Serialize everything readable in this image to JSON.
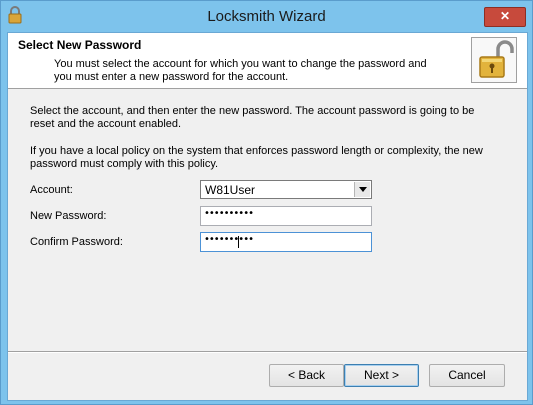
{
  "window": {
    "title": "Locksmith Wizard",
    "close_label": "✕"
  },
  "header": {
    "title": "Select New Password",
    "description": "You must select the account for which you want to change the password and you must enter a new password for the account."
  },
  "body": {
    "paragraph1": "Select the account, and then enter the new password. The account password is going to be reset and the account enabled.",
    "paragraph2": "If you have a local policy on the system that enforces password length or complexity, the new password must comply with this policy."
  },
  "form": {
    "account_label": "Account:",
    "account_value": "W81User",
    "new_password_label": "New Password:",
    "new_password_value": "••••••••••",
    "confirm_password_label": "Confirm Password:",
    "confirm_password_value": "••••••••••"
  },
  "buttons": {
    "back": "< Back",
    "next": "Next >",
    "cancel": "Cancel"
  },
  "icons": {
    "app": "lock-icon",
    "header": "open-padlock-icon",
    "dropdown": "chevron-down-icon"
  },
  "colors": {
    "titlebar": "#7dc3ec",
    "close": "#c74a3c",
    "padlock": "#e2b33c"
  }
}
